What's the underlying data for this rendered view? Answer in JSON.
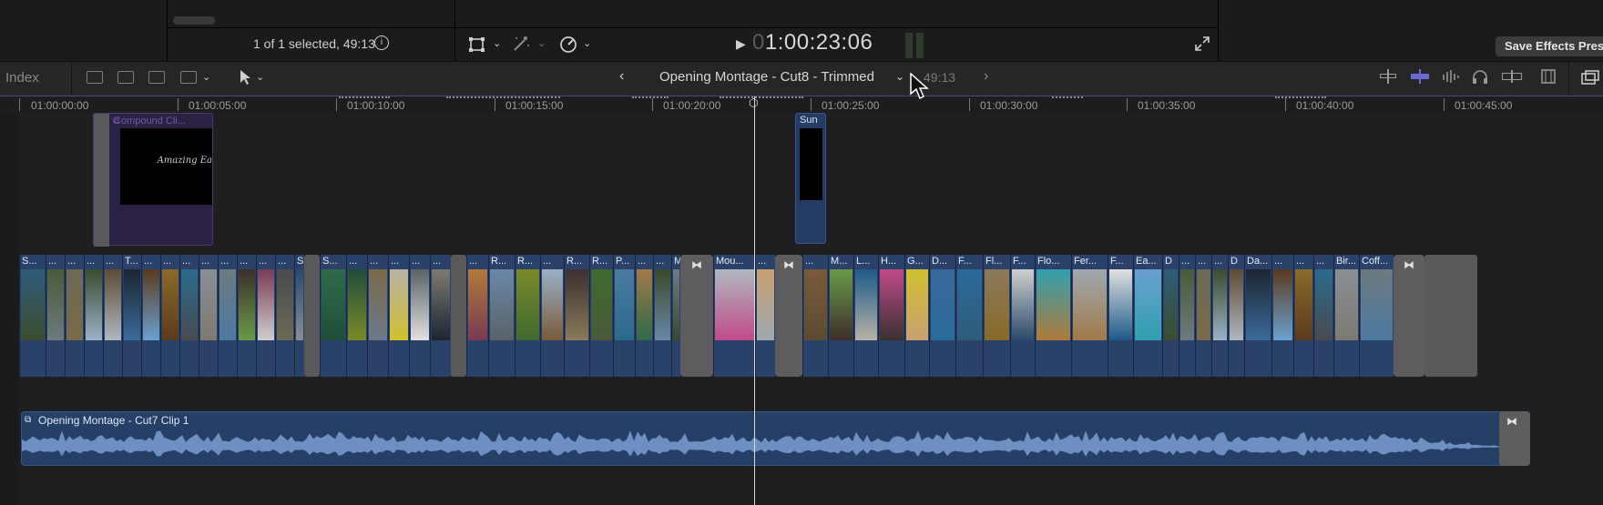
{
  "viewer": {
    "selection_info": "1 of 1 selected, 49:13",
    "timecode_dim": "0",
    "timecode": "1:00:23:06",
    "save_effects_preset": "Save Effects Prese"
  },
  "toolbar": {
    "index_tab": "Index",
    "project_name": "Opening Montage - Cut8 - Trimmed",
    "project_duration": "49:13"
  },
  "ruler": {
    "ticks": [
      "01:00:00:00",
      "01:00:05:00",
      "01:00:10:00",
      "01:00:15:00",
      "01:00:20:00",
      "01:00:25:00",
      "01:00:30:00",
      "01:00:35:00",
      "01:00:40:00",
      "01:00:45:00"
    ]
  },
  "connected_clips": {
    "compound_label": "Compound Cli...",
    "compound_thumb_text": "Amazing Ea",
    "sun_label": "Sun"
  },
  "storyline_labels": [
    "S...",
    "...",
    "...",
    "...",
    "...",
    "T...",
    "...",
    "...",
    "...",
    "...",
    "...",
    "...",
    "...",
    "...",
    "S",
    "S...",
    "...",
    "...",
    "...",
    "...",
    "...",
    "...",
    "R...",
    "R...",
    "...",
    "R...",
    "R...",
    "P...",
    "...",
    "...",
    "M",
    "Mou...",
    "...",
    "...",
    "M...",
    "L...",
    "H...",
    "G...",
    "D...",
    "F...",
    "Fl...",
    "F...",
    "Flo...",
    "Fer...",
    "F...",
    "Ea...",
    "D",
    "...",
    "...",
    "...",
    "D",
    "Da...",
    "...",
    "...",
    "...",
    "Bir...",
    "Coff..."
  ],
  "audio": {
    "label": "Opening Montage - Cut7 Clip 1"
  },
  "colors": {
    "clip_blue": "#2a4269",
    "compound_purple": "#2b2143",
    "playhead": "#d9d9d9",
    "toolbar_accent": "#4a4a82"
  },
  "icons": [
    "info-icon",
    "transform-icon",
    "enhance-icon",
    "speed-icon",
    "play-icon",
    "fullscreen-icon",
    "clip-appearance-icon",
    "select-tool-icon",
    "headphones-icon",
    "filmstrip-icon",
    "compound-clip-icon"
  ]
}
